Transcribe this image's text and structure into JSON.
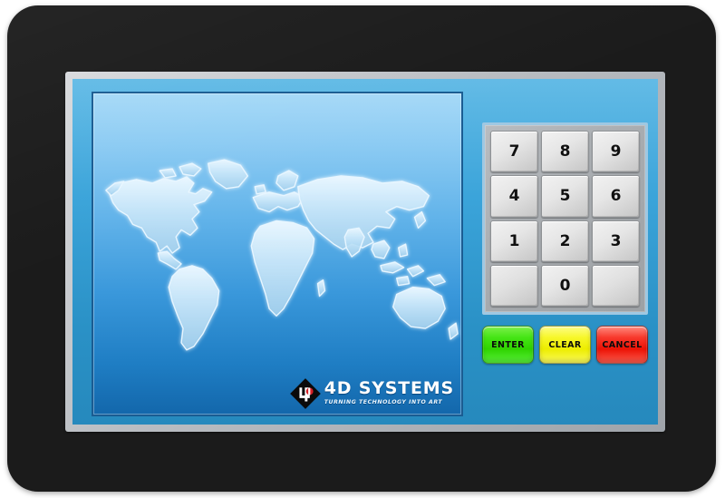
{
  "device": {
    "name": "4D Systems touchscreen display module",
    "bezel_color": "#1b1b1b",
    "frame_color": "#b9bdc2"
  },
  "screen": {
    "background_color": "#2f97cd",
    "map_panel": {
      "name": "world-map",
      "border_color": "#1a5c92",
      "gradient_top": "#a6d9f7",
      "gradient_bottom": "#1367ab",
      "land_color": "#cfeaff"
    },
    "brand": {
      "mark": "4d-logo-icon",
      "name": "4D SYSTEMS",
      "tagline": "TURNING TECHNOLOGY INTO ART",
      "mark_color": "#0a0a0a",
      "accent_color": "#d61f26"
    }
  },
  "keypad": {
    "panel_color": "#a7abaf",
    "panel_border_color": "#9fc8e2",
    "rows": [
      [
        {
          "label": "7",
          "blank": false
        },
        {
          "label": "8",
          "blank": false
        },
        {
          "label": "9",
          "blank": false
        }
      ],
      [
        {
          "label": "4",
          "blank": false
        },
        {
          "label": "5",
          "blank": false
        },
        {
          "label": "6",
          "blank": false
        }
      ],
      [
        {
          "label": "1",
          "blank": false
        },
        {
          "label": "2",
          "blank": false
        },
        {
          "label": "3",
          "blank": false
        }
      ],
      [
        {
          "label": "",
          "blank": true
        },
        {
          "label": "0",
          "blank": false
        },
        {
          "label": "",
          "blank": true
        }
      ]
    ],
    "actions": [
      {
        "label": "ENTER",
        "style": "enter",
        "color": "#2fd400"
      },
      {
        "label": "CLEAR",
        "style": "clear",
        "color": "#eded00"
      },
      {
        "label": "CANCEL",
        "style": "cancel",
        "color": "#ec1205"
      }
    ]
  }
}
